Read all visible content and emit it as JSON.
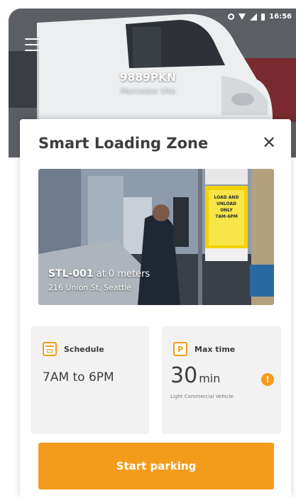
{
  "status_bar": {
    "time": "16:56"
  },
  "vehicle": {
    "plate": "9889PKN",
    "model": "Mercedes Vito"
  },
  "card": {
    "title": "Smart Loading Zone",
    "close_symbol": "✕",
    "zone": {
      "id": "STL-001",
      "distance": "at 0 meters",
      "address": "216 Union St, Seattle"
    },
    "sign_text": [
      "LOAD AND",
      "UNLOAD",
      "ONLY",
      "7AM-6PM"
    ],
    "schedule": {
      "label": "Schedule",
      "value": "7AM to 6PM",
      "icon": "calendar-icon"
    },
    "max_time": {
      "label": "Max time",
      "icon_letter": "P",
      "value": "30",
      "unit": "min",
      "info_symbol": "!",
      "vehicle_class": "Light Commercial Vehicle"
    },
    "start_button": "Start parking"
  },
  "colors": {
    "accent": "#f39c1b",
    "text": "#3d3d3d",
    "box": "#f2f2f2"
  }
}
